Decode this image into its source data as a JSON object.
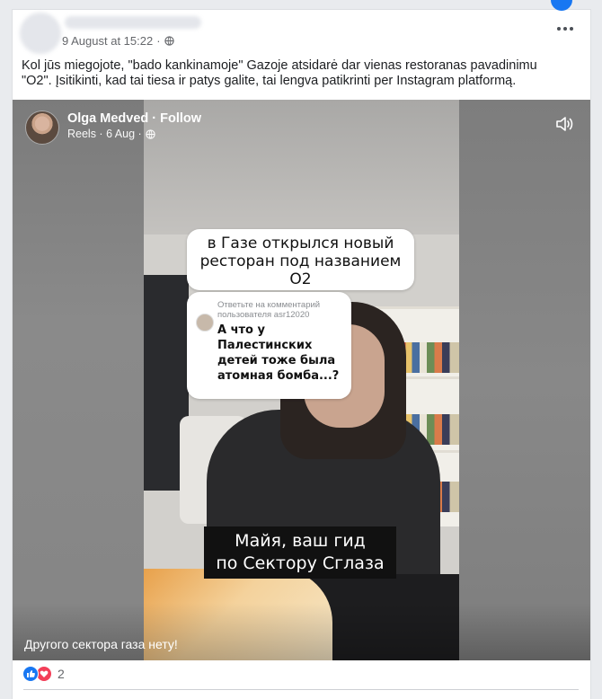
{
  "post": {
    "timestamp": "9 August at 15:22",
    "separator": "·",
    "text": "Kol jūs miegojote,  \"bado kankinamoje\" Gazoje atsidarė dar vienas restoranas pavadinimu\n\"O2\". Įsitikinti, kad tai tiesa ir patys galite, tai lengva  patikrinti per Instagram  platformą."
  },
  "video": {
    "author": "Olga Medved · Follow",
    "sub_label": "Reels · 6 Aug ·",
    "caption": "Другого сектора газа  нету!",
    "bubble_main": [
      "в Газе открылся новый",
      "ресторан под названием",
      "О2"
    ],
    "reply_header": "Ответьте на комментарий пользователя asr12020",
    "reply_text": "А что у Палестинских детей тоже была атомная бомба...?",
    "subtitle": [
      "Майя, ваш гид",
      "по Сектору Сглаза"
    ]
  },
  "reactions": {
    "count": "2"
  },
  "colors": {
    "brand_blue": "#1877f2",
    "love_red": "#f33e58",
    "meta_gray": "#65676b"
  },
  "icons": [
    "globe-icon",
    "more-options-icon",
    "sound-icon",
    "like-reaction-icon",
    "love-reaction-icon"
  ]
}
